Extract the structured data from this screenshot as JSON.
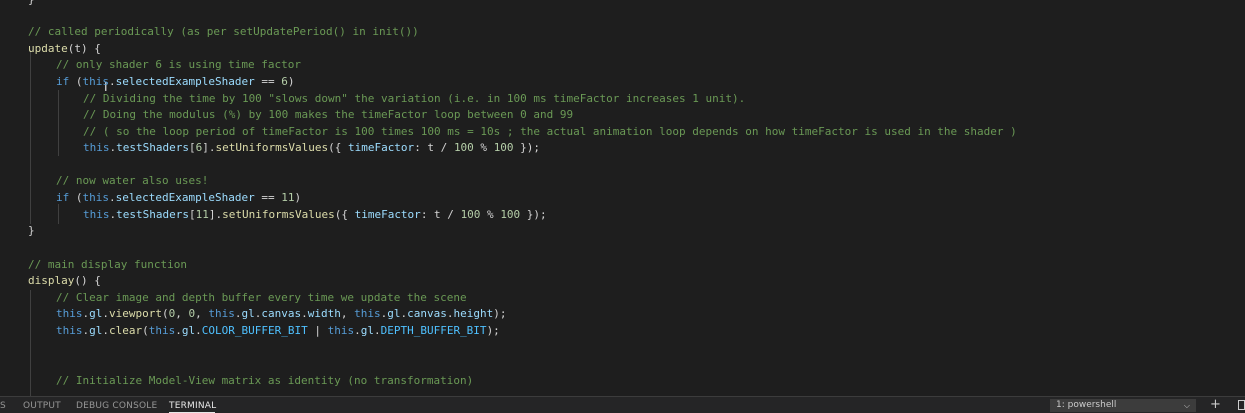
{
  "editor": {
    "lines": [
      [
        [
          "}",
          "plain"
        ]
      ],
      [
        [
          "// called periodically (as per setUpdatePeriod() in init())",
          "comment"
        ]
      ],
      [
        [
          "update",
          "func"
        ],
        [
          "(t) {",
          "plain"
        ]
      ],
      [
        [
          "// only shader 6 is using time factor",
          "comment"
        ]
      ],
      [
        [
          "if ",
          "keyword"
        ],
        [
          "(",
          "plain"
        ],
        [
          "this",
          "keyword"
        ],
        [
          ".",
          "plain"
        ],
        [
          "selectedExampleShader",
          "prop"
        ],
        [
          " == ",
          "plain"
        ],
        [
          "6",
          "num"
        ],
        [
          ")",
          "plain"
        ]
      ],
      [
        [
          "// Dividing the time by 100 \"slows down\" the variation (i.e. in 100 ms timeFactor increases 1 unit).",
          "comment"
        ]
      ],
      [
        [
          "// Doing the modulus (%) by 100 makes the timeFactor loop between 0 and 99",
          "comment"
        ]
      ],
      [
        [
          "// ( so the loop period of timeFactor is 100 times 100 ms = 10s ; the actual animation loop depends on how timeFactor is used in the shader )",
          "comment"
        ]
      ],
      [
        [
          "this",
          "keyword"
        ],
        [
          ".",
          "plain"
        ],
        [
          "testShaders",
          "prop"
        ],
        [
          "[",
          "plain"
        ],
        [
          "6",
          "num"
        ],
        [
          "].",
          "plain"
        ],
        [
          "setUniformsValues",
          "func"
        ],
        [
          "({ ",
          "plain"
        ],
        [
          "timeFactor",
          "prop"
        ],
        [
          ": t / ",
          "plain"
        ],
        [
          "100",
          "num"
        ],
        [
          " % ",
          "plain"
        ],
        [
          "100",
          "num"
        ],
        [
          " });",
          "plain"
        ]
      ],
      [],
      [
        [
          "// now water also uses!",
          "comment"
        ]
      ],
      [
        [
          "if ",
          "keyword"
        ],
        [
          "(",
          "plain"
        ],
        [
          "this",
          "keyword"
        ],
        [
          ".",
          "plain"
        ],
        [
          "selectedExampleShader",
          "prop"
        ],
        [
          " == ",
          "plain"
        ],
        [
          "11",
          "num"
        ],
        [
          ")",
          "plain"
        ]
      ],
      [
        [
          "this",
          "keyword"
        ],
        [
          ".",
          "plain"
        ],
        [
          "testShaders",
          "prop"
        ],
        [
          "[",
          "plain"
        ],
        [
          "11",
          "num"
        ],
        [
          "].",
          "plain"
        ],
        [
          "setUniformsValues",
          "func"
        ],
        [
          "({ ",
          "plain"
        ],
        [
          "timeFactor",
          "prop"
        ],
        [
          ": t / ",
          "plain"
        ],
        [
          "100",
          "num"
        ],
        [
          " % ",
          "plain"
        ],
        [
          "100",
          "num"
        ],
        [
          " });",
          "plain"
        ]
      ],
      [
        [
          "}",
          "plain"
        ]
      ],
      [],
      [
        [
          "// main display function",
          "comment"
        ]
      ],
      [
        [
          "display",
          "func"
        ],
        [
          "() {",
          "plain"
        ]
      ],
      [
        [
          "// Clear image and depth buffer every time we update the scene",
          "comment"
        ]
      ],
      [
        [
          "this",
          "keyword"
        ],
        [
          ".",
          "plain"
        ],
        [
          "gl",
          "prop"
        ],
        [
          ".",
          "plain"
        ],
        [
          "viewport",
          "func"
        ],
        [
          "(",
          "plain"
        ],
        [
          "0",
          "num"
        ],
        [
          ", ",
          "plain"
        ],
        [
          "0",
          "num"
        ],
        [
          ", ",
          "plain"
        ],
        [
          "this",
          "keyword"
        ],
        [
          ".",
          "plain"
        ],
        [
          "gl",
          "prop"
        ],
        [
          ".",
          "plain"
        ],
        [
          "canvas",
          "prop"
        ],
        [
          ".",
          "plain"
        ],
        [
          "width",
          "prop"
        ],
        [
          ", ",
          "plain"
        ],
        [
          "this",
          "keyword"
        ],
        [
          ".",
          "plain"
        ],
        [
          "gl",
          "prop"
        ],
        [
          ".",
          "plain"
        ],
        [
          "canvas",
          "prop"
        ],
        [
          ".",
          "plain"
        ],
        [
          "height",
          "prop"
        ],
        [
          ");",
          "plain"
        ]
      ],
      [
        [
          "this",
          "keyword"
        ],
        [
          ".",
          "plain"
        ],
        [
          "gl",
          "prop"
        ],
        [
          ".",
          "plain"
        ],
        [
          "clear",
          "func"
        ],
        [
          "(",
          "plain"
        ],
        [
          "this",
          "keyword"
        ],
        [
          ".",
          "plain"
        ],
        [
          "gl",
          "prop"
        ],
        [
          ".",
          "plain"
        ],
        [
          "COLOR_BUFFER_BIT",
          "const"
        ],
        [
          " | ",
          "plain"
        ],
        [
          "this",
          "keyword"
        ],
        [
          ".",
          "plain"
        ],
        [
          "gl",
          "prop"
        ],
        [
          ".",
          "plain"
        ],
        [
          "DEPTH_BUFFER_BIT",
          "const"
        ],
        [
          ");",
          "plain"
        ]
      ],
      [],
      [],
      [
        [
          "// Initialize Model-View matrix as identity (no transformation)",
          "comment"
        ]
      ]
    ]
  },
  "panel": {
    "tabs": [
      {
        "label": "S",
        "active": false
      },
      {
        "label": "OUTPUT",
        "active": false
      },
      {
        "label": "DEBUG CONSOLE",
        "active": false
      },
      {
        "label": "TERMINAL",
        "active": true
      }
    ],
    "terminal_select": "1: powershell",
    "chevron_icon": "chevron-down-icon",
    "add_icon": "plus-icon",
    "split_icon": "split-terminal-icon"
  }
}
